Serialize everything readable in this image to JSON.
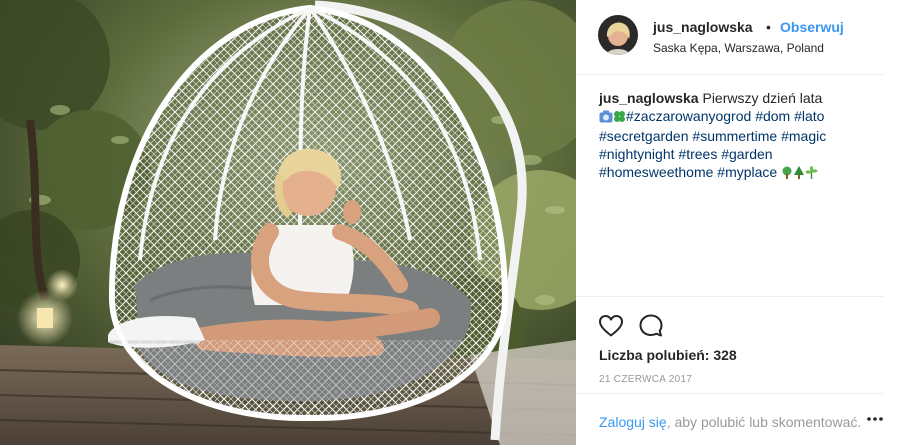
{
  "post": {
    "photo_description_icon": "photo-of-woman-in-hanging-egg-chair",
    "user": {
      "username": "jus_naglowska",
      "separator": "•",
      "follow_label": "Obserwuj",
      "location": "Saska Kępa, Warszawa, Poland"
    },
    "caption": {
      "username": "jus_naglowska",
      "text": "Pierwszy dzień lata",
      "hashtags": [
        "#zaczarowanyogrod",
        "#dom",
        "#lato",
        "#secretgarden",
        "#summertime",
        "#magic",
        "#nightynight",
        "#trees",
        "#garden",
        "#homesweethome",
        "#myplace"
      ]
    },
    "likes_text": "Liczba polubień: 328",
    "date": "21 CZERWCA 2017",
    "footer": {
      "login_link": "Zaloguj się",
      "rest": ", aby polubić lub skomentować."
    },
    "icons": {
      "like": "heart-icon",
      "comment": "comment-icon",
      "more": "more-options-icon"
    },
    "colors": {
      "link_blue": "#3897f0",
      "hashtag": "#003569",
      "muted": "#999999",
      "text": "#262626"
    }
  }
}
